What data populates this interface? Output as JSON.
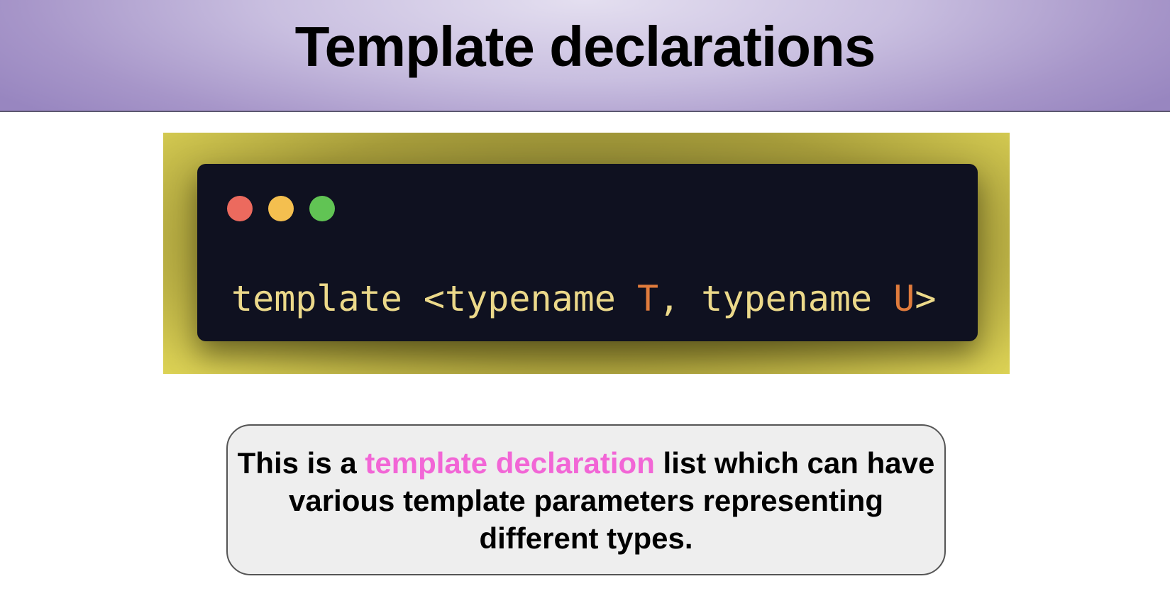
{
  "header": {
    "title": "Template declarations"
  },
  "code_window": {
    "controls": {
      "close_icon": "red-dot-icon",
      "minimize_icon": "yellow-dot-icon",
      "maximize_icon": "green-dot-icon"
    },
    "code": {
      "keyword": "template",
      "open": " <typename ",
      "param1": "T",
      "sep": ", typename ",
      "param2": "U",
      "close": ">"
    }
  },
  "callout": {
    "text_before": "This is a ",
    "highlight": "template declaration",
    "text_after": " list which can have various template parameters representing different types."
  },
  "colors": {
    "header_gradient": "#c9bfe0",
    "code_background": "#0f1120",
    "code_text": "#ecd98a",
    "code_param": "#e07b3c",
    "panel_background": "#e6dd5a",
    "highlight": "#f266d6",
    "callout_background": "#eeeeee"
  }
}
